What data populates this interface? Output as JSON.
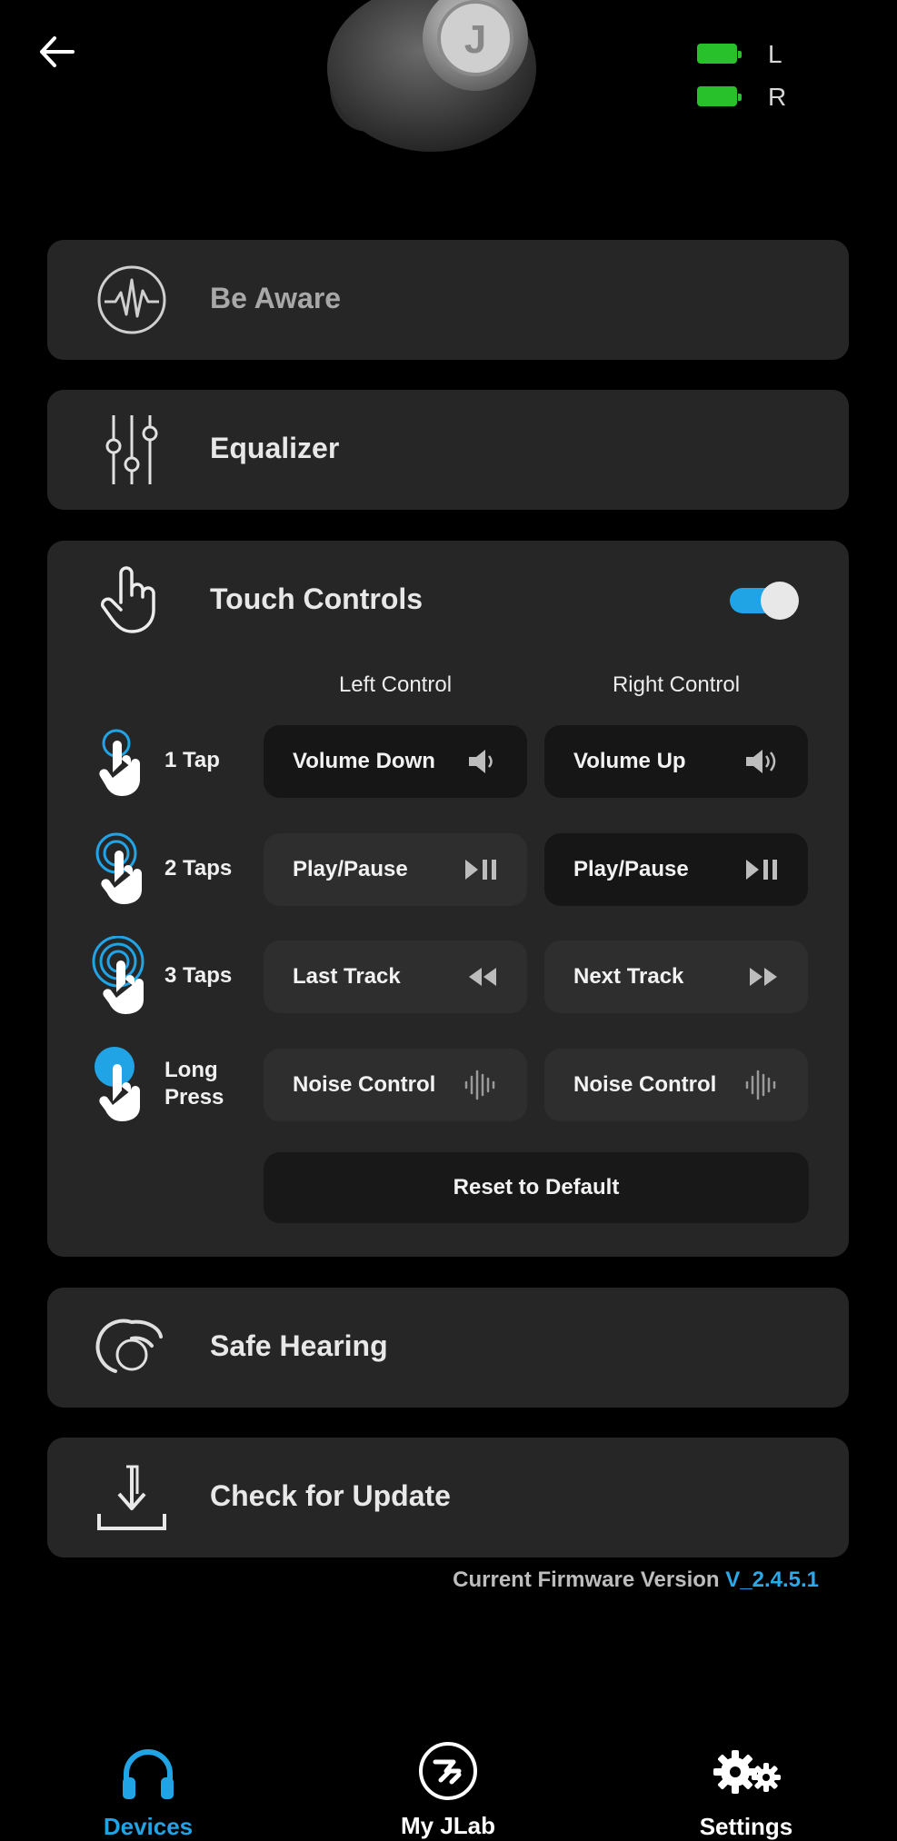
{
  "header": {
    "battery_left_label": "L",
    "battery_right_label": "R",
    "battery_color": "#29c12b"
  },
  "cards": {
    "be_aware": "Be Aware",
    "equalizer": "Equalizer",
    "touch_controls": "Touch Controls",
    "safe_hearing": "Safe Hearing",
    "check_update": "Check for Update"
  },
  "touch": {
    "enabled": true,
    "left_header": "Left Control",
    "right_header": "Right Control",
    "rows": [
      {
        "label": "1 Tap",
        "left": "Volume Down",
        "left_icon": "speaker-low-icon",
        "right": "Volume Up",
        "right_icon": "speaker-high-icon"
      },
      {
        "label": "2 Taps",
        "left": "Play/Pause",
        "left_icon": "play-pause-icon",
        "right": "Play/Pause",
        "right_icon": "play-pause-icon"
      },
      {
        "label": "3 Taps",
        "left": "Last Track",
        "left_icon": "rewind-icon",
        "right": "Next Track",
        "right_icon": "fast-forward-icon"
      },
      {
        "label_line1": "Long",
        "label_line2": "Press",
        "left": "Noise Control",
        "left_icon": "waveform-icon",
        "right": "Noise Control",
        "right_icon": "waveform-icon"
      }
    ],
    "reset": "Reset to Default"
  },
  "firmware": {
    "label": "Current Firmware Version",
    "version": "V_2.4.5.1"
  },
  "nav": {
    "devices": "Devices",
    "myjlab": "My JLab",
    "settings": "Settings",
    "active_color": "#21a4e6"
  }
}
